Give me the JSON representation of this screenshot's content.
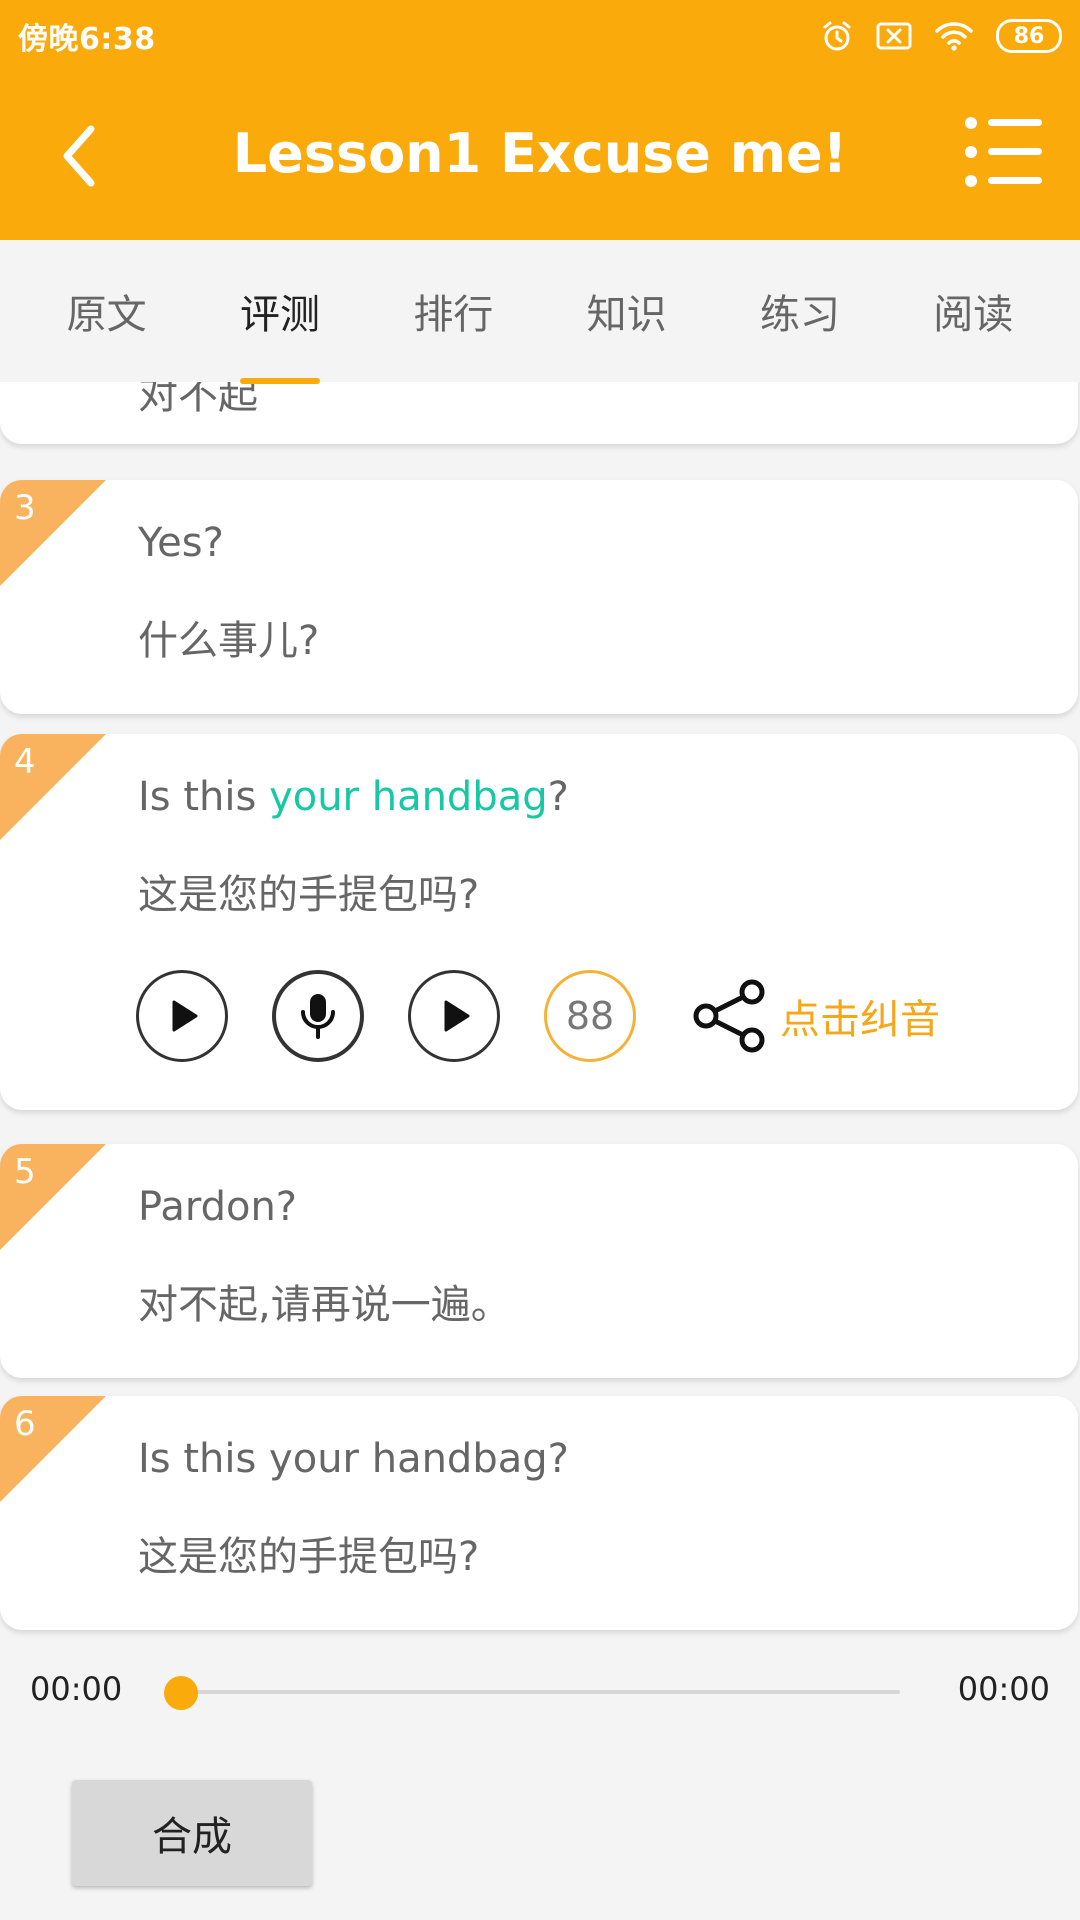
{
  "status_bar": {
    "time": "傍晚6:38",
    "battery": "86",
    "icons": [
      "alarm-icon",
      "no-sim-icon",
      "wifi-icon",
      "battery-icon"
    ]
  },
  "header": {
    "title": "Lesson1 Excuse me!",
    "back_icon": "chevron-left-icon",
    "menu_icon": "list-menu-icon"
  },
  "tabs": [
    {
      "label": "原文",
      "active": false
    },
    {
      "label": "评测",
      "active": true
    },
    {
      "label": "排行",
      "active": false
    },
    {
      "label": "知识",
      "active": false
    },
    {
      "label": "练习",
      "active": false
    },
    {
      "label": "阅读",
      "active": false
    }
  ],
  "sentences": [
    {
      "num": "",
      "en": "",
      "zh": "对不起"
    },
    {
      "num": "3",
      "en": "Yes?",
      "zh": "什么事儿?"
    },
    {
      "num": "4",
      "en_pre": "Is this ",
      "en_highlight": "your handbag",
      "en_post": "?",
      "zh": "这是您的手提包吗?",
      "score": "88",
      "correct_label": "点击纠音"
    },
    {
      "num": "5",
      "en": "Pardon?",
      "zh": "对不起,请再说一遍。"
    },
    {
      "num": "6",
      "en": "Is this your handbag?",
      "zh": "这是您的手提包吗?"
    }
  ],
  "player": {
    "current": "00:00",
    "total": "00:00",
    "progress": 0
  },
  "synth_button": "合成",
  "colors": {
    "accent": "#fbaa0c",
    "highlight": "#16c8a4",
    "corner": "#f9b25e"
  }
}
